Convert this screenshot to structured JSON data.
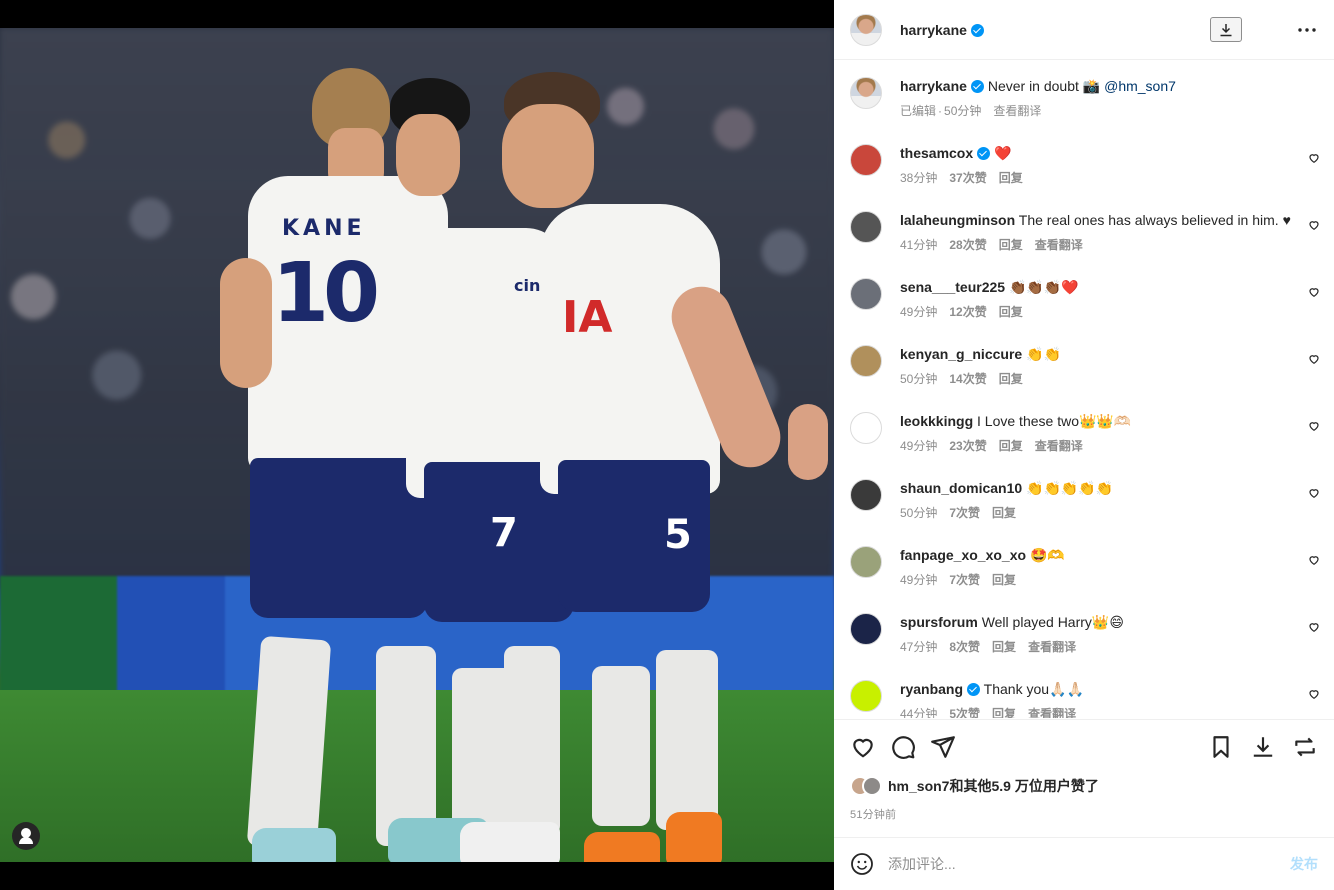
{
  "post": {
    "author": "harrykane",
    "verified": true,
    "caption_text": "Never in doubt 📸",
    "caption_mention": "@hm_son7",
    "edited_label": "已编辑",
    "separator": "·",
    "post_time": "50分钟",
    "translate_label": "查看翻译",
    "likes_text": "hm_son7和其他5.9 万位用户赞了",
    "time_ago": "51分钟前"
  },
  "comments": [
    {
      "user": "thesamcox",
      "verified": true,
      "text": "❤️",
      "time": "38分钟",
      "likes": "37次赞",
      "reply": "回复",
      "translate": "",
      "avatar_color": "#c9473b"
    },
    {
      "user": "lalaheungminson",
      "verified": false,
      "text": "The real ones has always believed in him. ♥",
      "time": "41分钟",
      "likes": "28次赞",
      "reply": "回复",
      "translate": "查看翻译",
      "avatar_color": "#555555"
    },
    {
      "user": "sena___teur225",
      "verified": false,
      "text": "👏🏾👏🏾👏🏾❤️",
      "time": "49分钟",
      "likes": "12次赞",
      "reply": "回复",
      "translate": "",
      "avatar_color": "#6b6f78"
    },
    {
      "user": "kenyan_g_niccure",
      "verified": false,
      "text": "👏👏",
      "time": "50分钟",
      "likes": "14次赞",
      "reply": "回复",
      "translate": "",
      "avatar_color": "#b0905c"
    },
    {
      "user": "leokkkingg",
      "verified": false,
      "text": "I Love these two👑👑🫶🏻",
      "time": "49分钟",
      "likes": "23次赞",
      "reply": "回复",
      "translate": "查看翻译",
      "avatar_color": "#ffffff"
    },
    {
      "user": "shaun_domican10",
      "verified": false,
      "text": "👏👏👏👏👏",
      "time": "50分钟",
      "likes": "7次赞",
      "reply": "回复",
      "translate": "",
      "avatar_color": "#3a3a3a"
    },
    {
      "user": "fanpage_xo_xo_xo",
      "verified": false,
      "text": "🤩🫶",
      "time": "49分钟",
      "likes": "7次赞",
      "reply": "回复",
      "translate": "",
      "avatar_color": "#9aa27a"
    },
    {
      "user": "spursforum",
      "verified": false,
      "text": "Well played Harry👑😄",
      "time": "47分钟",
      "likes": "8次赞",
      "reply": "回复",
      "translate": "查看翻译",
      "avatar_color": "#1b2448"
    },
    {
      "user": "ryanbang",
      "verified": true,
      "text": "Thank you🙏🏻🙏🏻",
      "time": "44分钟",
      "likes": "5次赞",
      "reply": "回复",
      "translate": "查看翻译",
      "avatar_color": "#c8f000"
    }
  ],
  "composer": {
    "placeholder": "添加评论...",
    "post_label": "发布"
  },
  "photo": {
    "kane_name": "KANE",
    "kane_number": "10",
    "son_number": "7",
    "hojbjerg_number": "5",
    "sponsor": "cinch",
    "shirt_letters": "IA"
  },
  "colors": {
    "accent": "#0095f6",
    "spurs_navy": "#1c2a6b"
  },
  "icons": [
    "download-icon",
    "more-icon",
    "heart-icon",
    "comment-icon",
    "share-icon",
    "bookmark-icon",
    "save-download-icon",
    "repost-icon",
    "emoji-icon",
    "profile-icon"
  ]
}
